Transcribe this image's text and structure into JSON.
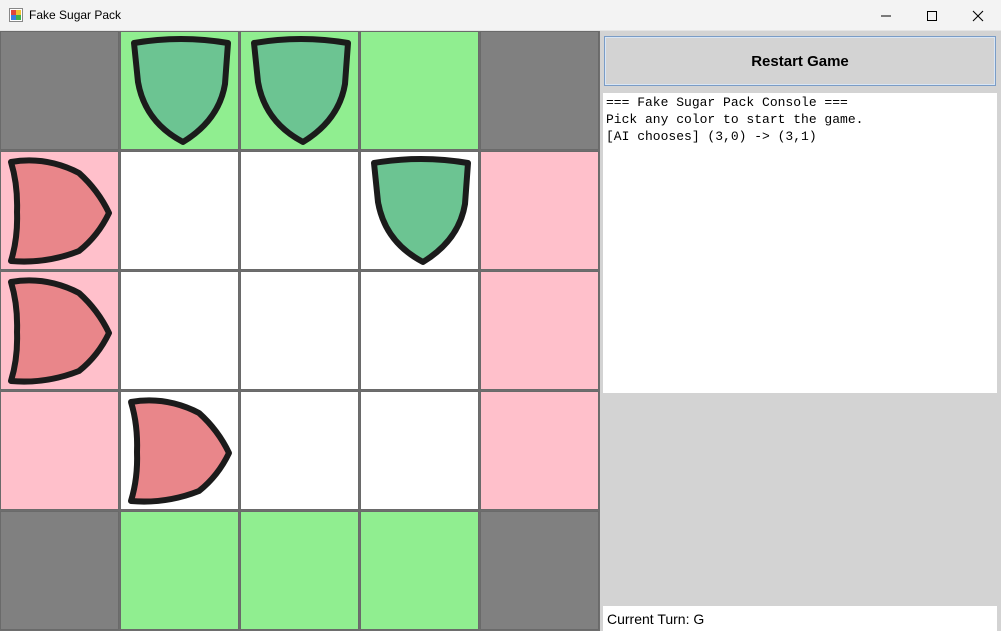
{
  "window": {
    "title": "Fake Sugar Pack",
    "icon": "app-icon",
    "controls": [
      "minimize-icon",
      "maximize-icon",
      "close-icon"
    ]
  },
  "colors": {
    "gray": "#808080",
    "green": "#90ee90",
    "pink": "#ffc0cb",
    "white": "#ffffff",
    "green_piece": "#6cc492",
    "red_piece": "#e9868a"
  },
  "board": {
    "rows": [
      [
        {
          "bg": "gray"
        },
        {
          "bg": "green",
          "piece": "green-shield"
        },
        {
          "bg": "green",
          "piece": "green-shield"
        },
        {
          "bg": "green"
        },
        {
          "bg": "gray"
        }
      ],
      [
        {
          "bg": "pink",
          "piece": "red-arrow"
        },
        {
          "bg": "white"
        },
        {
          "bg": "white"
        },
        {
          "bg": "white",
          "piece": "green-shield"
        },
        {
          "bg": "pink"
        }
      ],
      [
        {
          "bg": "pink",
          "piece": "red-arrow"
        },
        {
          "bg": "white"
        },
        {
          "bg": "white"
        },
        {
          "bg": "white"
        },
        {
          "bg": "pink"
        }
      ],
      [
        {
          "bg": "pink"
        },
        {
          "bg": "white",
          "piece": "red-arrow"
        },
        {
          "bg": "white"
        },
        {
          "bg": "white"
        },
        {
          "bg": "pink"
        }
      ],
      [
        {
          "bg": "gray"
        },
        {
          "bg": "green"
        },
        {
          "bg": "green"
        },
        {
          "bg": "green"
        },
        {
          "bg": "gray"
        }
      ]
    ]
  },
  "sidebar": {
    "restart_label": "Restart Game",
    "console_lines": [
      "=== Fake Sugar Pack Console ===",
      "Pick any color to start the game.",
      "[AI chooses] (3,0) -> (3,1)"
    ],
    "turn_label": "Current Turn: G"
  }
}
